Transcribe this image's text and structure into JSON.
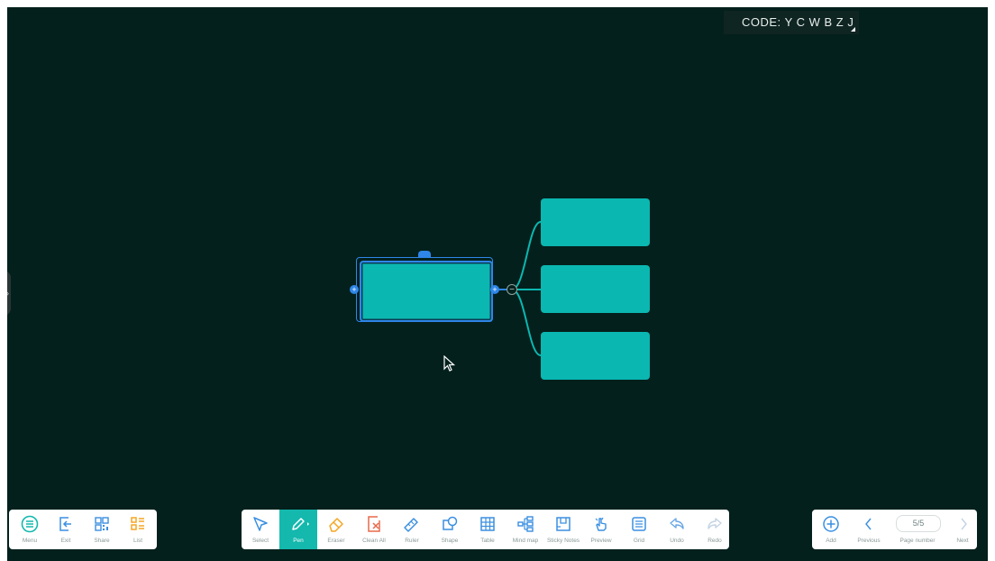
{
  "code_badge": {
    "label": "CODE:",
    "value": "Y C W B Z J"
  },
  "side_handle": {
    "glyph": "›"
  },
  "mindmap": {
    "root_handles": {
      "left": "+",
      "right": "+"
    },
    "collapse_toggle": "−"
  },
  "left_toolbar": {
    "items": [
      {
        "label": "Menu",
        "icon": "menu-icon"
      },
      {
        "label": "Exit",
        "icon": "exit-icon"
      },
      {
        "label": "Share",
        "icon": "qr-share-icon"
      },
      {
        "label": "List",
        "icon": "list-icon"
      }
    ]
  },
  "main_toolbar": {
    "active": "Pen",
    "items": [
      {
        "label": "Select",
        "icon": "select-arrow-icon"
      },
      {
        "label": "Pen",
        "icon": "pen-icon"
      },
      {
        "label": "Eraser",
        "icon": "eraser-icon"
      },
      {
        "label": "Clean All",
        "icon": "clean-all-icon"
      },
      {
        "label": "Ruler",
        "icon": "ruler-icon"
      },
      {
        "label": "Shape",
        "icon": "shape-icon"
      },
      {
        "label": "Table",
        "icon": "table-icon"
      },
      {
        "label": "Mind map",
        "icon": "mind-map-icon"
      },
      {
        "label": "Sticky Notes",
        "icon": "sticky-notes-icon"
      },
      {
        "label": "Preview",
        "icon": "preview-hand-icon"
      },
      {
        "label": "Grid",
        "icon": "grid-icon"
      },
      {
        "label": "Undo",
        "icon": "undo-icon"
      },
      {
        "label": "Redo",
        "icon": "redo-icon"
      }
    ]
  },
  "right_toolbar": {
    "add_label": "Add",
    "previous_label": "Previous",
    "page_number_label": "Page number",
    "page_value": "5/5",
    "next_label": "Next"
  },
  "colors": {
    "canvas": "#03201c",
    "node": "#0bb7b1",
    "selection": "#2e86e8",
    "accent": "#14b8ad",
    "icon_blue": "#3a8fe0",
    "icon_orange": "#f5a623",
    "icon_red": "#e8684a"
  }
}
